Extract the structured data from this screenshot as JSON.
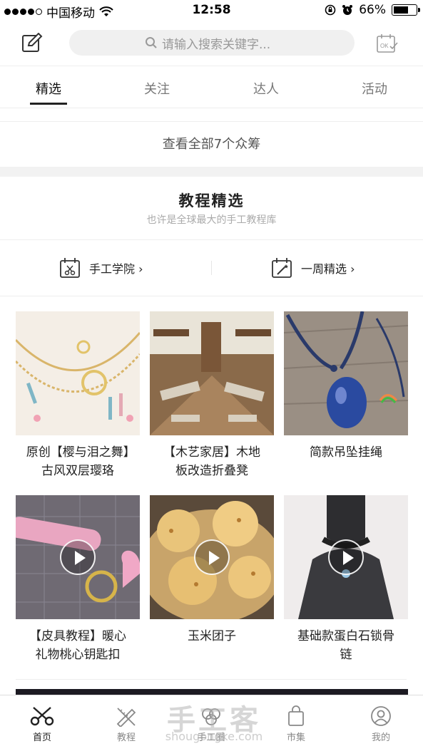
{
  "status_bar": {
    "carrier": "中国移动",
    "time": "12:58",
    "battery": "66%"
  },
  "search": {
    "placeholder": "请输入搜索关键字..."
  },
  "tabs": [
    {
      "label": "精选",
      "active": true
    },
    {
      "label": "关注",
      "active": false
    },
    {
      "label": "达人",
      "active": false
    },
    {
      "label": "活动",
      "active": false
    }
  ],
  "crowdfund": {
    "label": "查看全部7个众筹"
  },
  "section": {
    "title": "教程精选",
    "subtitle": "也许是全球最大的手工教程库"
  },
  "categories": [
    {
      "label": "手工学院 ›",
      "icon": "calendar-scissors-icon"
    },
    {
      "label": "一周精选 ›",
      "icon": "calendar-wand-icon"
    }
  ],
  "tutorials": [
    {
      "title": "原创【樱与泪之舞】古风双层璎珞",
      "video": false
    },
    {
      "title": "【木艺家居】木地板改造折叠凳",
      "video": false
    },
    {
      "title": "简款吊坠挂绳",
      "video": false
    },
    {
      "title": "【皮具教程】暖心礼物桃心钥匙扣",
      "video": true
    },
    {
      "title": "玉米团子",
      "video": true
    },
    {
      "title": "基础款蛋白石锁骨链",
      "video": true
    }
  ],
  "tabbar": [
    {
      "label": "首页",
      "icon": "scissors-icon",
      "active": true
    },
    {
      "label": "教程",
      "icon": "pencil-ruler-icon",
      "active": false
    },
    {
      "label": "手工圈",
      "icon": "cloud-icon",
      "active": false
    },
    {
      "label": "市集",
      "icon": "shopping-bag-icon",
      "active": false
    },
    {
      "label": "我的",
      "icon": "user-icon",
      "active": false
    }
  ],
  "watermark": {
    "brand": "手工客",
    "url": "shougongke.com"
  },
  "colors": {
    "accent": "#222222",
    "muted": "#888888",
    "divider": "#eeeeee"
  }
}
